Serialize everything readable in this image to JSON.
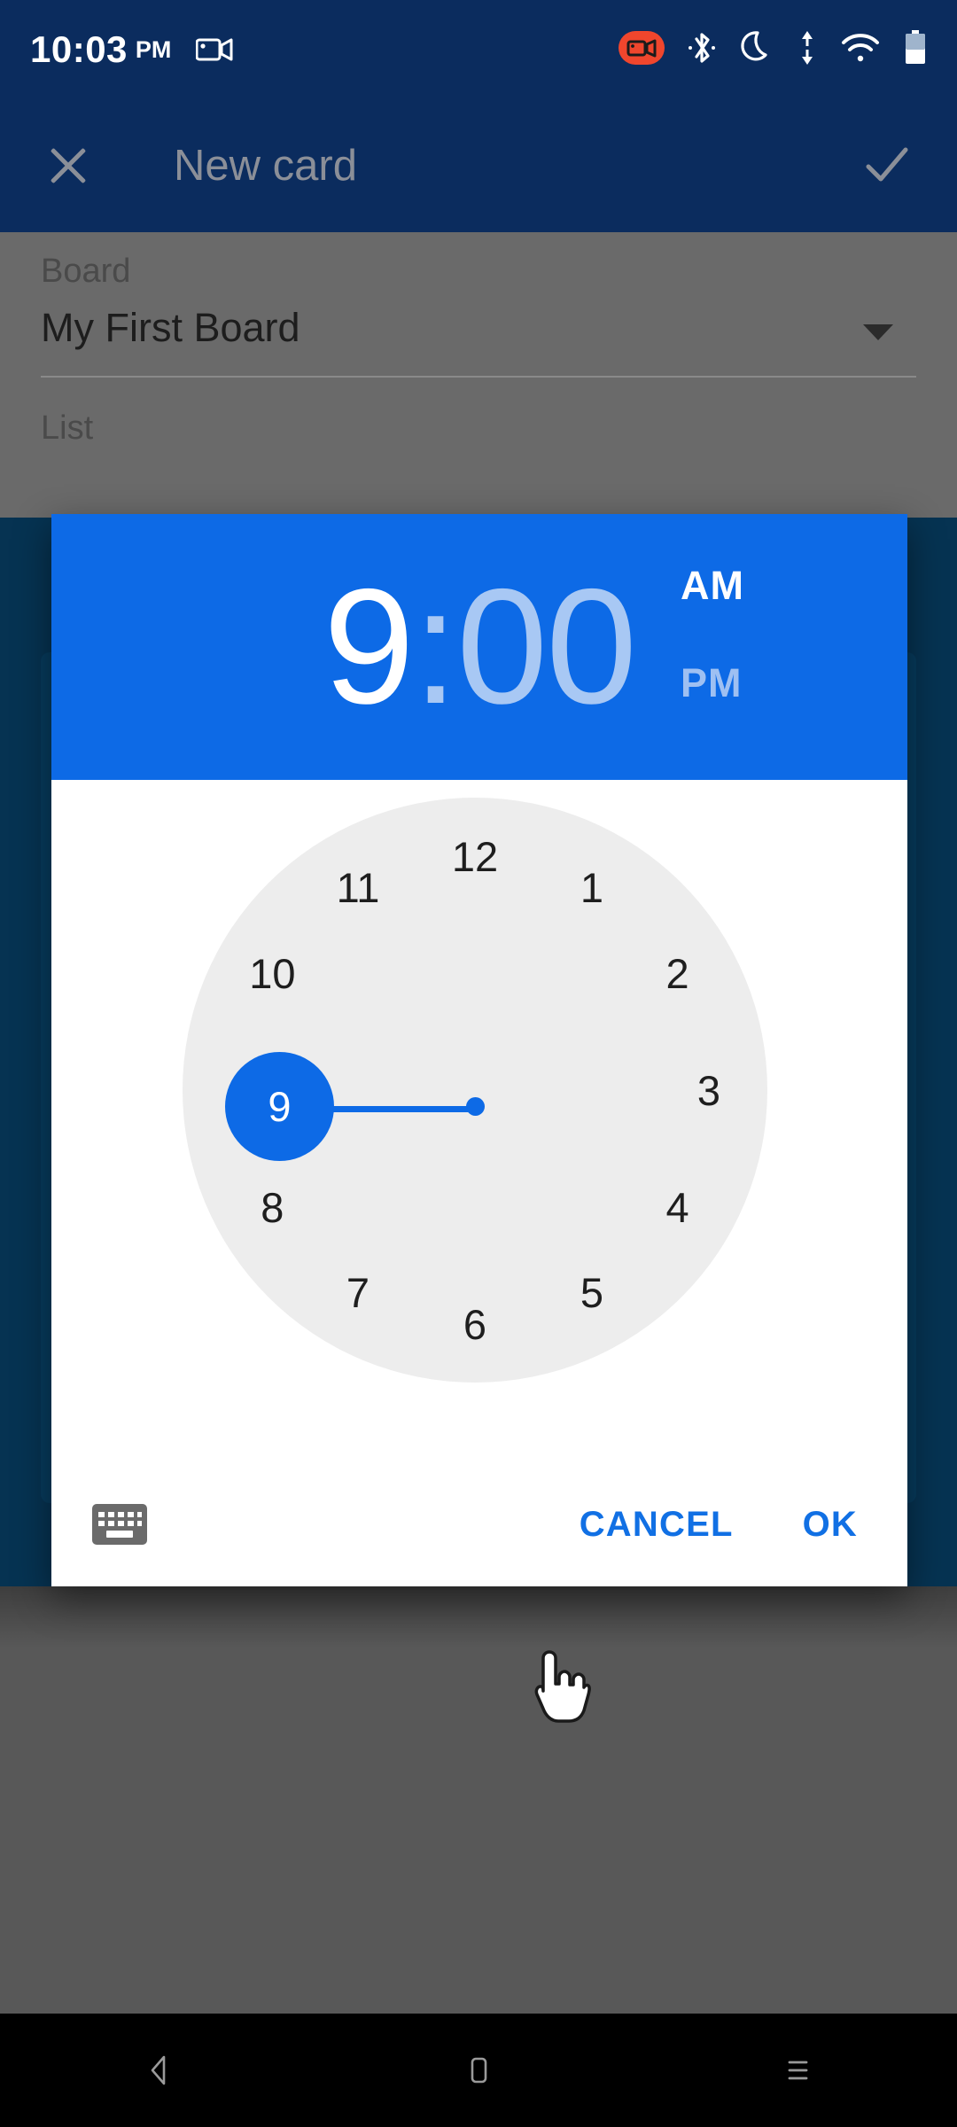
{
  "status_bar": {
    "time": "10:03",
    "ampm": "PM",
    "icons": [
      "screen-record-icon",
      "bluetooth-icon",
      "do-not-disturb-moon-icon",
      "data-transfer-icon",
      "wifi-icon",
      "battery-icon"
    ],
    "record_badge_color": "#f0462d",
    "background": "#0b2c5e"
  },
  "app_bar": {
    "close_label": "close-icon",
    "title": "New card",
    "confirm_label": "check-icon",
    "background": "#0b2c5e",
    "title_color": "#8b8f98"
  },
  "form": {
    "board_label": "Board",
    "board_value": "My First Board",
    "list_label": "List"
  },
  "dialog": {
    "header": {
      "hour": "9",
      "colon": ":",
      "minute": "00",
      "am_label": "AM",
      "pm_label": "PM",
      "selected_meridiem": "AM",
      "background": "#0d6ae6",
      "active_color": "#ffffff",
      "inactive_color": "#a8c8f4"
    },
    "clock": {
      "mode": "hour",
      "selected_hour": "9",
      "face_color": "#ededed",
      "accent_color": "#0d6ae6",
      "numbers": [
        {
          "label": "12",
          "angle": 0
        },
        {
          "label": "1",
          "angle": 30
        },
        {
          "label": "2",
          "angle": 60
        },
        {
          "label": "3",
          "angle": 90
        },
        {
          "label": "4",
          "angle": 120
        },
        {
          "label": "5",
          "angle": 150
        },
        {
          "label": "6",
          "angle": 180
        },
        {
          "label": "7",
          "angle": 210
        },
        {
          "label": "8",
          "angle": 240
        },
        {
          "label": "9",
          "angle": 270
        },
        {
          "label": "10",
          "angle": 300
        },
        {
          "label": "11",
          "angle": 330
        }
      ]
    },
    "actions": {
      "keyboard_toggle": "keyboard-icon",
      "cancel_label": "CANCEL",
      "ok_label": "OK",
      "button_color": "#1170e4"
    }
  },
  "cursor": {
    "type": "pointing-hand-cursor",
    "over": "12"
  },
  "nav_bar": {
    "back_label": "back-icon",
    "home_label": "home-icon",
    "recents_label": "recents-icon"
  }
}
